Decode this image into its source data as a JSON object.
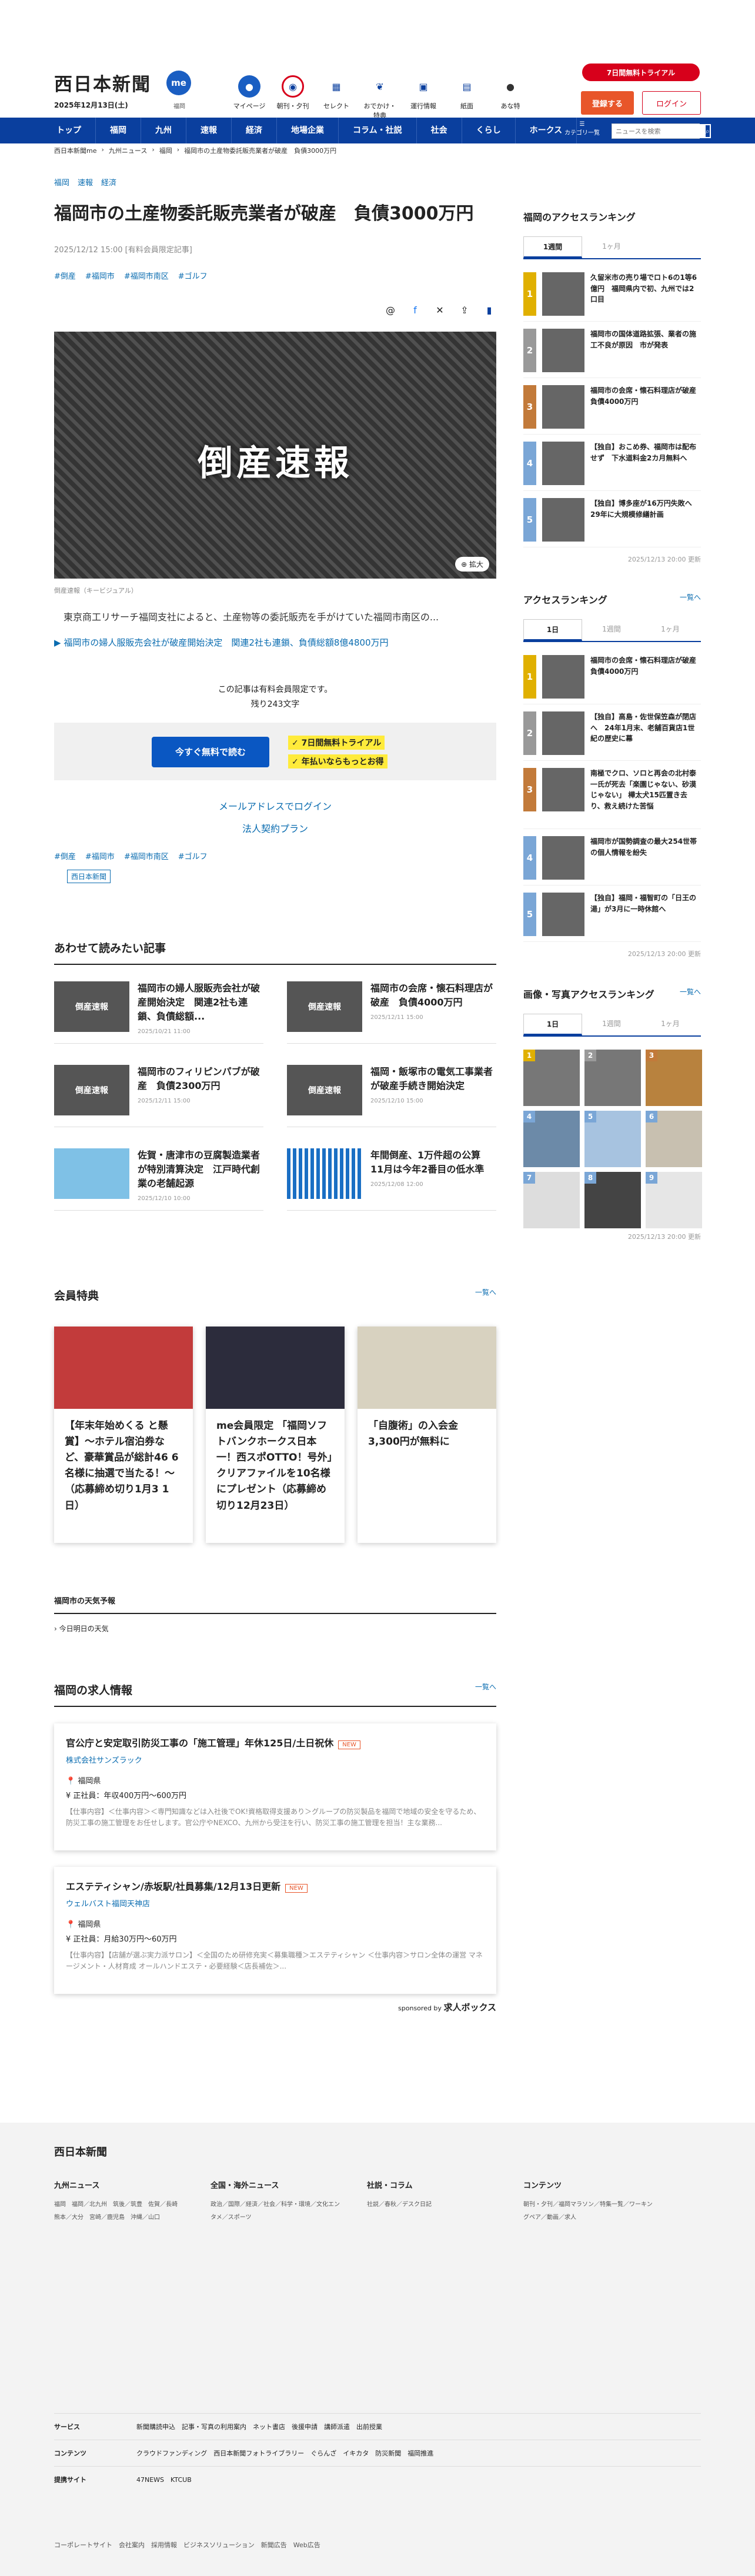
{
  "header": {
    "logo": "西日本新聞",
    "date": "2025年12月13日(土)",
    "mb": "me",
    "mb_sub": "福岡",
    "icons": [
      {
        "label": "マイページ",
        "icon": "user-icon",
        "color": "#1a5ec2"
      },
      {
        "label": "朝刊・夕刊",
        "icon": "newspaper-icon",
        "color": "#d7001b"
      },
      {
        "label": "セレクト",
        "icon": "select-icon",
        "color": "#0a3f9e"
      },
      {
        "label": "おでかけ・特典",
        "icon": "footprint-icon",
        "color": "#0a3f9e"
      },
      {
        "label": "運行情報",
        "icon": "train-icon",
        "color": "#0a3f9e"
      },
      {
        "label": "紙面",
        "icon": "paper-icon",
        "color": "#0a3f9e"
      },
      {
        "label": "あな特",
        "icon": "bear-icon",
        "color": "#333"
      }
    ],
    "trial": "7日間無料トライアル",
    "register": "登録する",
    "login": "ログイン"
  },
  "nav": {
    "items": [
      "トップ",
      "福岡",
      "九州",
      "速報",
      "経済",
      "地場企業",
      "コラム・社説",
      "社会",
      "くらし",
      "ホークス"
    ],
    "category": "カテゴリ一覧",
    "search_placeholder": "ニュースを検索"
  },
  "breadcrumb": [
    "西日本新聞me",
    "九州ニュース",
    "福岡",
    "福岡市の土産物委託販売業者が破産　負債3000万円"
  ],
  "article": {
    "tags": [
      "福岡",
      "速報",
      "経済"
    ],
    "title": "福岡市の土産物委託販売業者が破産　負債3000万円",
    "date": "2025/12/12 15:00 [有料会員限定記事]",
    "hashtags": [
      "#倒産",
      "#福岡市",
      "#福岡市南区",
      "#ゴルフ"
    ],
    "hero_text": "倒産速報",
    "enlarge": "拡大",
    "caption": "倒産速報（キービジュアル）",
    "lead": "　東京商工リサーチ福岡支社によると、土産物等の委託販売を手がけていた福岡市南区の...",
    "related": "福岡市の婦人服販売会社が破産開始決定　関連2社も連鎖、負債総額8億4800万円",
    "lock1": "この記事は有料会員限定です。",
    "lock2": "残り243文字",
    "paybtn": "今すぐ無料で読む",
    "merit1": "7日間無料トライアル",
    "merit2": "年払いならもっとお得",
    "mail": "メールアドレスでログイン",
    "corp": "法人契約プラン",
    "source": "西日本新聞"
  },
  "related_section": {
    "title": "あわせて読みたい記事",
    "cards": [
      {
        "thumb": "倒産速報",
        "title": "福岡市の婦人服販売会社が破産開始決定　関連2社も連鎖、負債総額...",
        "date": "2025/10/21 11:00"
      },
      {
        "thumb": "倒産速報",
        "title": "福岡市の会席・懐石料理店が破産　負債4000万円",
        "date": "2025/12/11 15:00"
      },
      {
        "thumb": "倒産速報",
        "title": "福岡市のフィリピンパブが破産　負債2300万円",
        "date": "2025/12/11 15:00"
      },
      {
        "thumb": "倒産速報",
        "title": "福岡・飯塚市の電気工事業者が破産手続き開始決定",
        "date": "2025/12/10 15:00"
      },
      {
        "thumb": "",
        "title": "佐賀・唐津市の豆腐製造業者が特別清算決定　江戸時代創業の老舗起源",
        "date": "2025/12/10 10:00"
      },
      {
        "thumb": "",
        "title": "年間倒産、1万件超の公算　11月は今年2番目の低水準",
        "date": "2025/12/08 12:00"
      }
    ]
  },
  "perks": {
    "title": "会員特典",
    "more": "一覧へ",
    "items": [
      {
        "title": "【年末年始めくる と懸賞】〜ホテル宿泊券など、豪華賞品が総計46 6名様に抽選で当たる！〜（応募締め切り1月3 1日）",
        "color": "#c23b3b"
      },
      {
        "title": "me会員限定 「福岡ソフトバンクホークス日本一！西スポOTTO！号外」クリアファイルを10名様にプレゼント（応募締め切り12月23日）",
        "color": "#2c2c3c"
      },
      {
        "title": "「自腹術」の入会金3,300円が無料に",
        "color": "#d8d2c0"
      }
    ]
  },
  "weather": {
    "title": "福岡市の天気予報",
    "link": "今日明日の天気"
  },
  "jobs": {
    "title": "福岡の求人情報",
    "more": "一覧へ",
    "items": [
      {
        "title": "官公庁と安定取引防災工事の「施工管理」年休125日/土日祝休",
        "new": "NEW",
        "company": "株式会社サンズラック",
        "area": "福岡県",
        "pay": "正社員：年収400万円〜600万円",
        "desc": "【仕事内容】＜仕事内容＞＜専門知識などは入社後でOK!資格取得支援あり＞グループの防災製品を福岡で地域の安全を守るため、防災工事の施工管理をお任せします。官公庁やNEXCO、九州から受注を行い、防災工事の施工管理を担当！主な業務..."
      },
      {
        "title": "エステティシャン/赤坂駅/社員募集/12月13日更新",
        "new": "NEW",
        "company": "ウェルバスト福岡天神店",
        "area": "福岡県",
        "pay": "正社員：月給30万円〜60万円",
        "desc": "【仕事内容】【店舗が選ぶ実力派サロン】＜全国のため研修充実＜募集職種＞エステティシャン ＜仕事内容＞サロン全体の運営 マネージメント・人材育成 オールハンドエステ・必要経験＜店長補佐＞..."
      }
    ],
    "sponsor": "sponsored by",
    "sponsor_name": "求人ボックス"
  },
  "side": {
    "ranking1": {
      "title": "福岡のアクセスランキング",
      "tabs": [
        "1週間",
        "1ヶ月"
      ],
      "items": [
        {
          "n": "1",
          "title": "久留米市の売り場でロト6の1等6億円　福岡県内で初、九州では2口目"
        },
        {
          "n": "2",
          "title": "福岡市の国体道路拡張、業者の施工不良が原因　市が発表"
        },
        {
          "n": "3",
          "title": "福岡市の会席・懐石料理店が破産　負債4000万円"
        },
        {
          "n": "4",
          "title": "【独自】おこめ券、福岡市は配布せず　下水道料金2カ月無料へ"
        },
        {
          "n": "5",
          "title": "【独自】博多座が16万円失敗へ　29年に大規模修繕計画"
        }
      ],
      "updated": "2025/12/13 20:00 更新"
    },
    "ranking2": {
      "title": "アクセスランキング",
      "more": "一覧へ",
      "tabs": [
        "1日",
        "1週間",
        "1ヶ月"
      ],
      "items": [
        {
          "n": "1",
          "title": "福岡市の会席・懐石料理店が破産　負債4000万円"
        },
        {
          "n": "2",
          "title": "【独自】高島・佐世保笠森が閉店へ　24年1月末、老舗百貨店1世紀の歴史に幕"
        },
        {
          "n": "3",
          "title": "南極でクロ、ソロと再会の北村泰一氏が死去「楽園じゃない、砂漠じゃない」 樺太犬15匹置き去り、救え続けた苦悩"
        },
        {
          "n": "4",
          "title": "福岡市が国勢調査の最大254世帯の個人情報を紛失"
        },
        {
          "n": "5",
          "title": "【独自】福岡・福智町の「日王の湯」が3月に一時休館へ"
        }
      ],
      "updated": "2025/12/13 20:00 更新"
    },
    "photo": {
      "title": "画像・写真アクセスランキング",
      "more": "一覧へ",
      "tabs": [
        "1日",
        "1週間",
        "1ヶ月"
      ],
      "n": [
        "1",
        "2",
        "3",
        "4",
        "5",
        "6",
        "7",
        "8",
        "9"
      ],
      "updated": "2025/12/13 20:00 更新"
    }
  },
  "footer": {
    "logo": "西日本新聞",
    "cols": [
      {
        "title": "九州ニュース",
        "items": "福岡　福岡／北九州　筑後／筑豊　佐賀／長崎　熊本／大分　宮崎／鹿児島　沖縄／山口"
      },
      {
        "title": "全国・海外ニュース",
        "items": "政治／国際／経済／社会／科学・環境／文化エンタメ／スポーツ"
      },
      {
        "title": "社説・コラム",
        "items": "社説／春秋／デスク日記"
      },
      {
        "title": "コンテンツ",
        "items": "朝刊・夕刊／福岡マラソン／特集一覧／ワーキングペア／動画／求人"
      }
    ],
    "rows": [
      {
        "k": "サービス",
        "v": "新聞購読申込　記事・写真の利用案内　ネット書店　後援申請　講師派遣　出前授業"
      },
      {
        "k": "コンテンツ",
        "v": "クラウドファンディング　西日本新聞フォトライブラリー　ぐらんざ　イキカタ　防災新聞　福岡推進"
      },
      {
        "k": "提携サイト",
        "v": "47NEWS　KTCUB"
      }
    ],
    "bottom": "コーポレートサイト　会社案内　採用情報　ビジネスソリューション　新聞広告　Web広告"
  }
}
